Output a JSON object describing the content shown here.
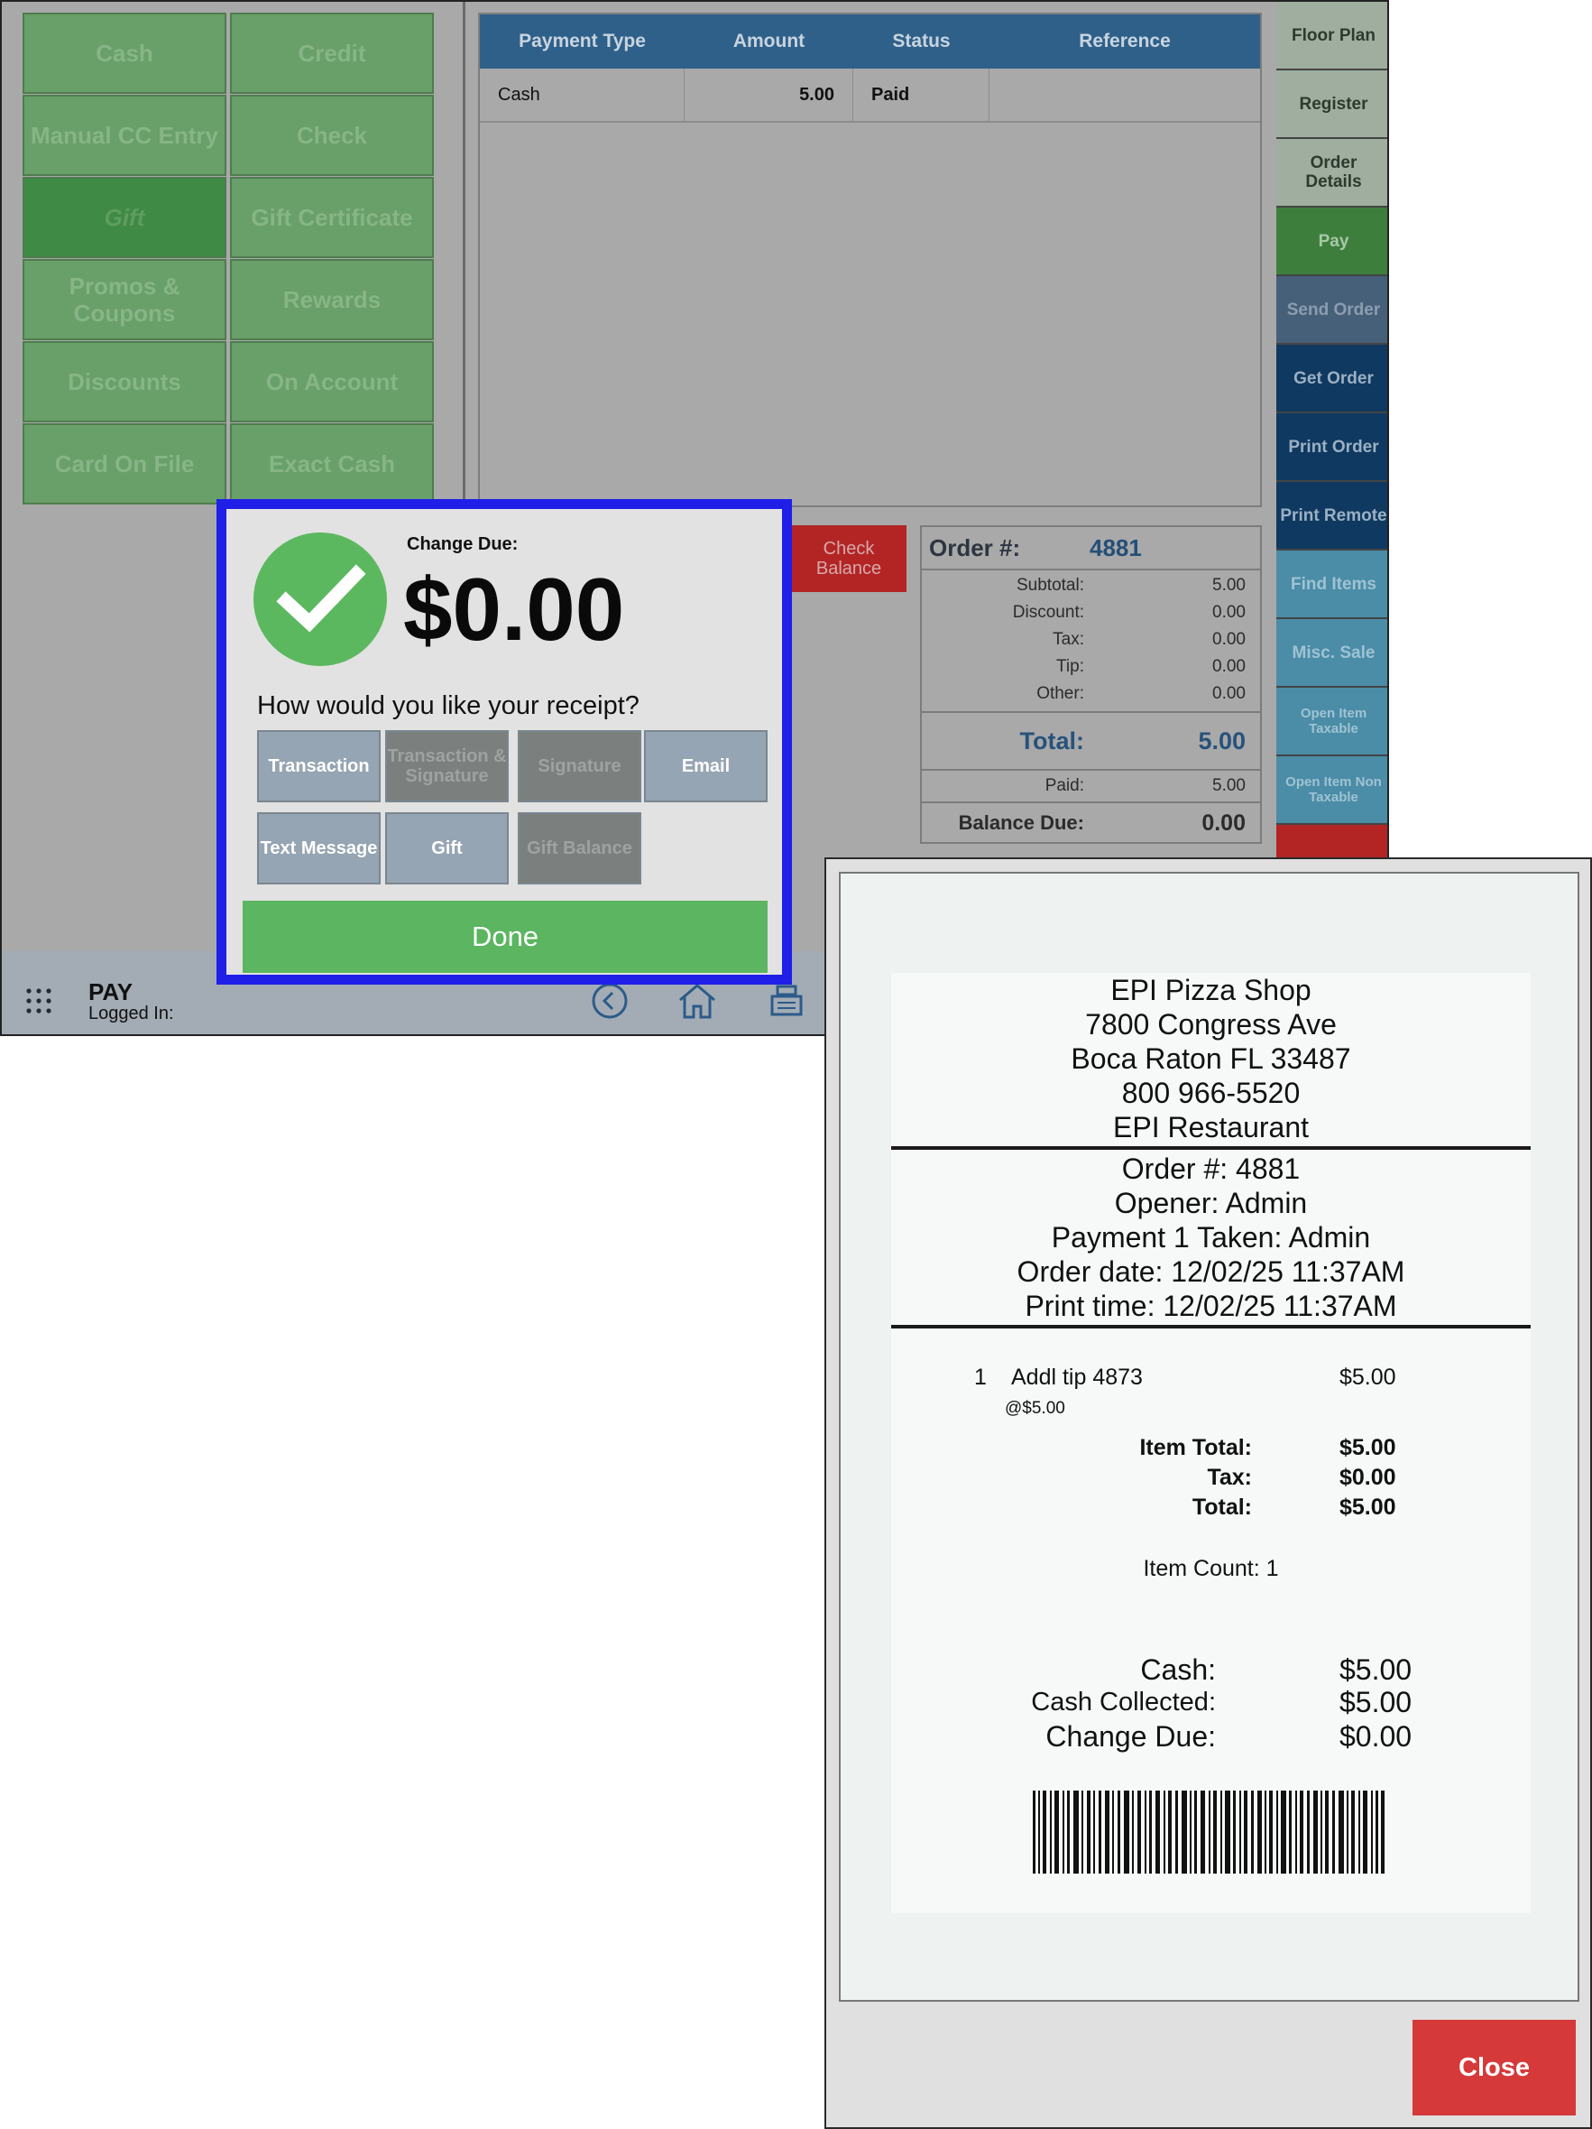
{
  "payment_methods": [
    "Cash",
    "Credit",
    "Manual CC Entry",
    "Check",
    "Gift",
    "Gift Certificate",
    "Promos & Coupons",
    "Rewards",
    "Discounts",
    "On Account",
    "Card On File",
    "Exact Cash"
  ],
  "payments_table": {
    "headers": [
      "Payment Type",
      "Amount",
      "Status",
      "Reference"
    ],
    "rows": [
      {
        "type": "Cash",
        "amount": "5.00",
        "status": "Paid",
        "reference": ""
      }
    ]
  },
  "check_balance_label": "Check Balance",
  "order_summary": {
    "order_label": "Order #:",
    "order_number": "4881",
    "subtotal_label": "Subtotal:",
    "subtotal": "5.00",
    "discount_label": "Discount:",
    "discount": "0.00",
    "tax_label": "Tax:",
    "tax": "0.00",
    "tip_label": "Tip:",
    "tip": "0.00",
    "other_label": "Other:",
    "other": "0.00",
    "total_label": "Total:",
    "total": "5.00",
    "paid_label": "Paid:",
    "paid": "5.00",
    "balance_label": "Balance Due:",
    "balance": "0.00"
  },
  "side_nav": [
    "Floor Plan",
    "Register",
    "Order Details",
    "Pay",
    "Send Order",
    "Get Order",
    "Print Order",
    "Print Remote",
    "Find Items",
    "Misc. Sale",
    "Open Item Taxable",
    "Open Item Non Taxable"
  ],
  "status_bar": {
    "screen": "PAY",
    "logged_in": "Logged In:"
  },
  "change_dialog": {
    "change_label": "Change Due:",
    "change_amount": "$0.00",
    "question": "How would you like your receipt?",
    "buttons": [
      "Transaction",
      "Transaction & Signature",
      "Signature",
      "Email",
      "Text Message",
      "Gift",
      "Gift Balance"
    ],
    "done": "Done"
  },
  "receipt": {
    "store_name": "EPI Pizza Shop",
    "address1": "7800 Congress Ave",
    "address2": "Boca Raton FL 33487",
    "phone": "800 966-5520",
    "restaurant": "EPI Restaurant",
    "order_line": "Order #: 4881",
    "opener": "Opener: Admin",
    "payment_taken": "Payment 1 Taken: Admin",
    "order_date": "Order date: 12/02/25 11:37AM",
    "print_time": "Print time: 12/02/25 11:37AM",
    "item_qty": "1",
    "item_name": "Addl tip 4873",
    "item_price": "$5.00",
    "item_unit": "@$5.00",
    "item_total_label": "Item Total:",
    "item_total": "$5.00",
    "tax_label": "Tax:",
    "tax": "$0.00",
    "total_label": "Total:",
    "total": "$5.00",
    "item_count": "Item Count: 1",
    "cash_label": "Cash:",
    "cash": "$5.00",
    "cash_collected_label": "Cash Collected:",
    "cash_collected": "$5.00",
    "change_due_label": "Change Due:",
    "change_due": "$0.00",
    "close": "Close"
  }
}
